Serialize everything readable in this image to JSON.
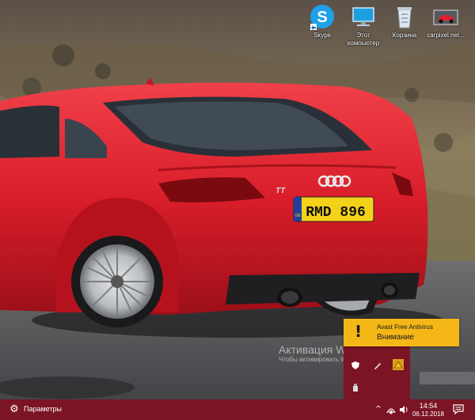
{
  "desktop": {
    "icons": [
      {
        "label": "Skype",
        "icon": "skype-icon"
      },
      {
        "label": "Этот\nкомпьютер",
        "icon": "computer-icon"
      },
      {
        "label": "Корзина",
        "icon": "recycle-bin-icon"
      },
      {
        "label": "carpixel.net...",
        "icon": "car-image-icon"
      }
    ]
  },
  "wallpaper": {
    "plate_text": "RMD 896",
    "plate_country": "GB",
    "badge_text": "TT"
  },
  "activation": {
    "title": "Активация Windows",
    "subtitle": "Чтобы активировать Windows, перейдите"
  },
  "toast": {
    "app": "Avast Free Antivirus",
    "message": "Внимание",
    "icon": "warning-exclamation-icon"
  },
  "taskbar": {
    "start_label": "Параметры",
    "time": "14:54",
    "date": "06.12.2018"
  },
  "colors": {
    "accent": "#7b1424",
    "toast_bg": "#f4b717",
    "car_red": "#d91e2a"
  }
}
